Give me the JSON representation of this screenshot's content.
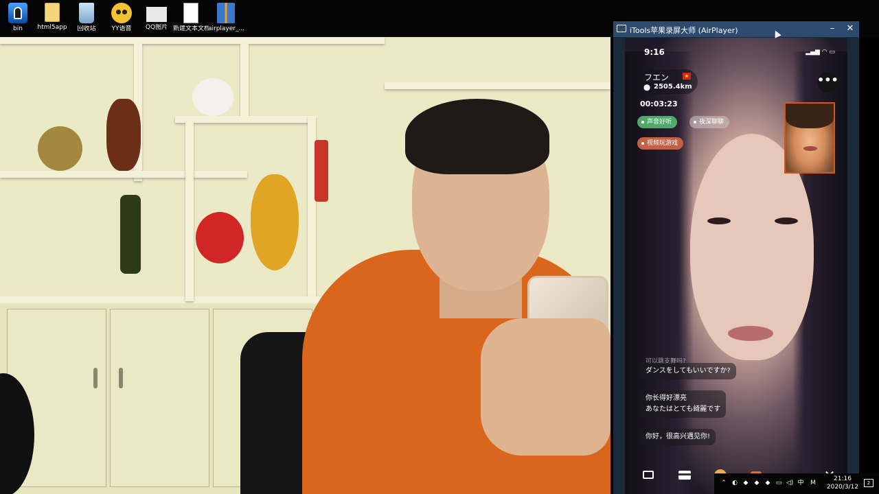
{
  "desktop": {
    "icons": [
      {
        "label": "bin",
        "icon": "app-icon"
      },
      {
        "label": "html5app",
        "icon": "folder-icon"
      },
      {
        "label": "回收站",
        "icon": "recycle-bin-icon"
      },
      {
        "label": "YY语音",
        "icon": "yy-voice-icon"
      },
      {
        "label": "QQ图片",
        "icon": "image-file-icon"
      },
      {
        "label": "新建文本文档",
        "icon": "text-document-icon"
      },
      {
        "label": "airplayer_...",
        "icon": "archive-icon"
      }
    ]
  },
  "airplayer_window": {
    "title": "iTools苹果录屏大师 (AirPlayer)",
    "minimize": "–",
    "close": "✕"
  },
  "phone": {
    "status_time": "9:16",
    "user": {
      "name": "フエン",
      "flag": "★",
      "distance": "2505.4km"
    },
    "call_timer": "00:03:23",
    "tags": [
      "声音好听",
      "夜深聊聊",
      "视频玩游戏"
    ],
    "chat": {
      "cut_off": "可以跳支舞吗?",
      "messages": [
        {
          "lines": [
            "ダンスをしてもいいですか?"
          ]
        },
        {
          "lines": [
            "你长得好漂亮",
            "あなたはとても綺麗です"
          ]
        },
        {
          "lines": [
            "你好，很高兴遇见你!"
          ]
        }
      ]
    },
    "toolbar": {
      "close": "✕"
    }
  },
  "taskbar": {
    "time": "21:16",
    "date": "2020/3/12",
    "ime": "中",
    "ime_mode": "M"
  },
  "colors": {
    "titlebar": "#2c4b6e",
    "shirt": "#d9661c",
    "tag_green": "#4ea96a",
    "tag_red": "#c26147"
  }
}
